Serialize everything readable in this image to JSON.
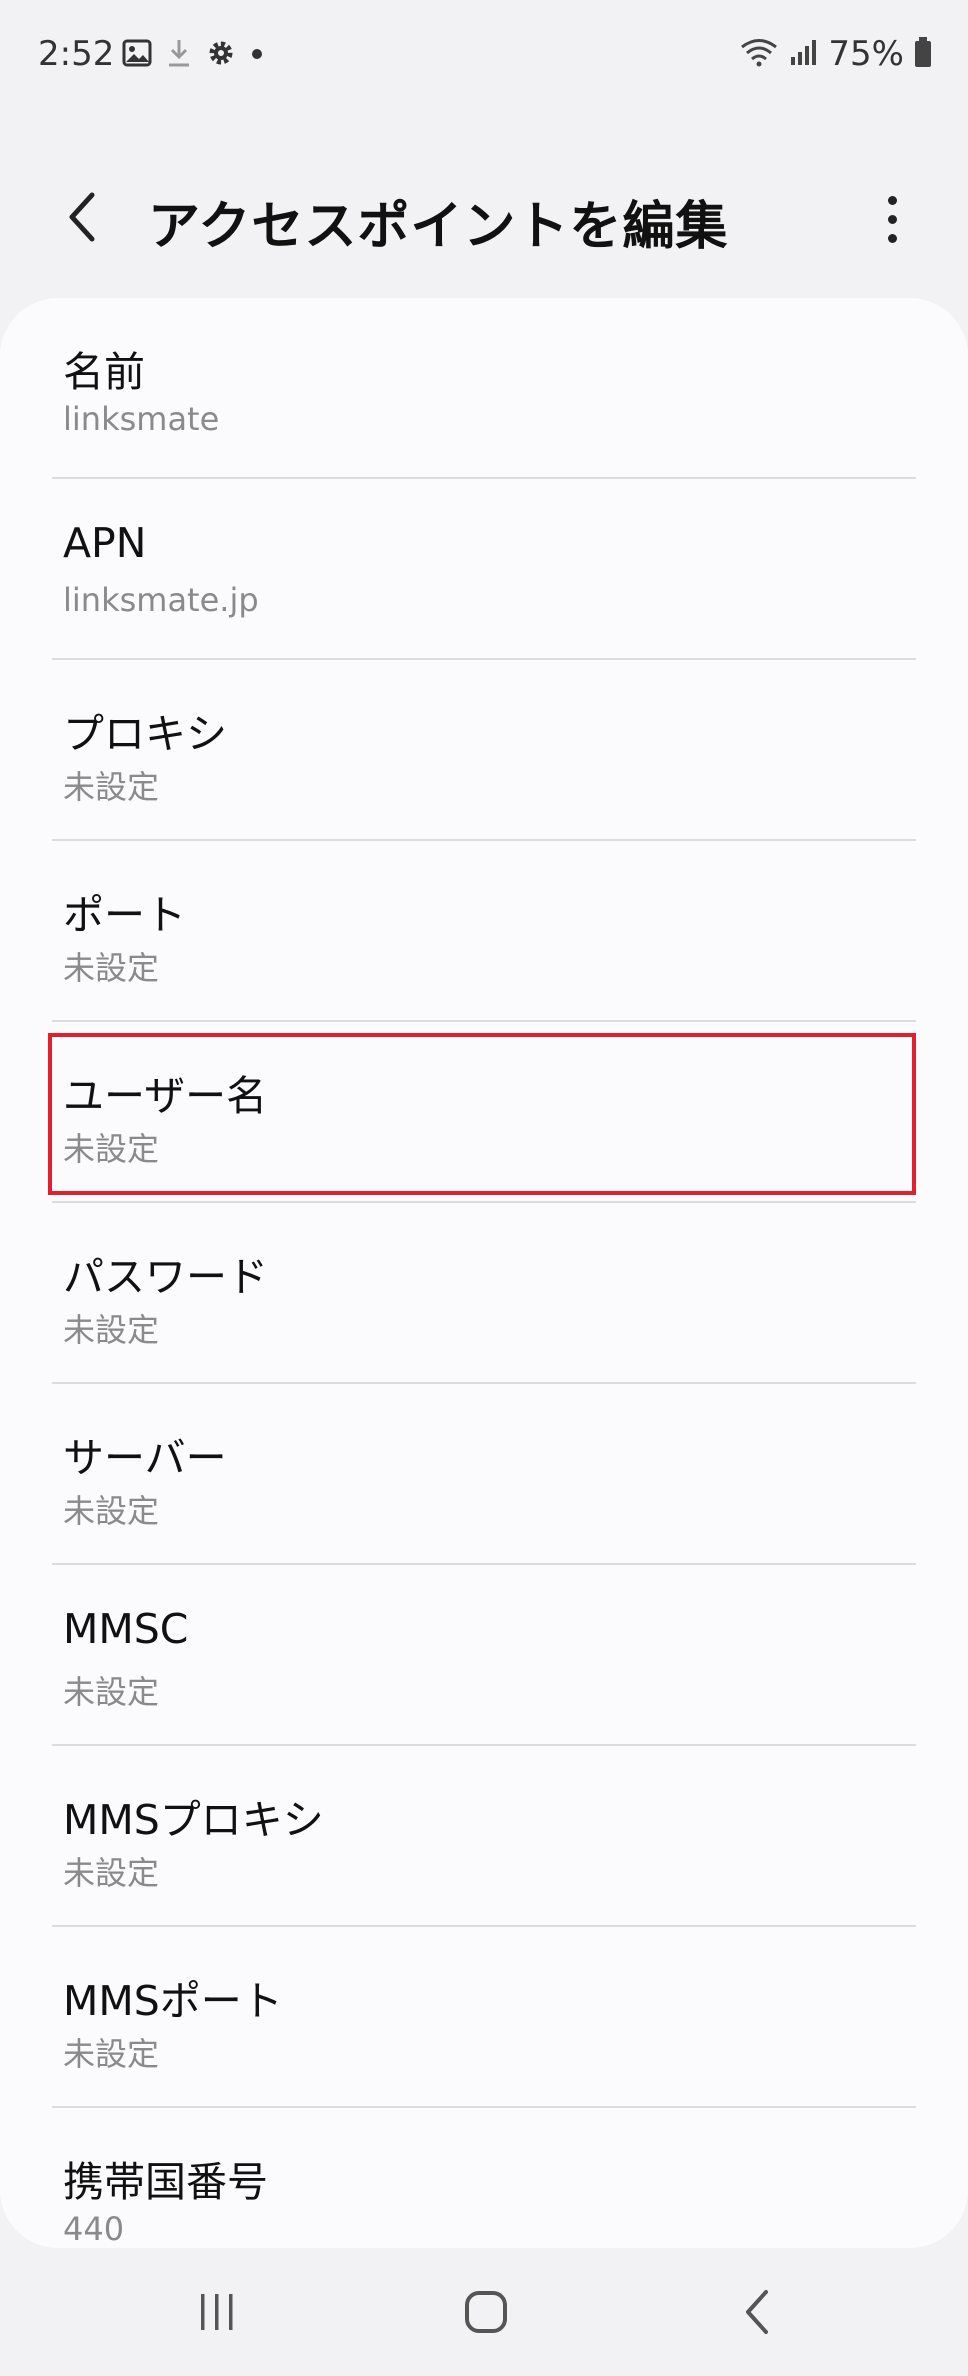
{
  "status_bar": {
    "time": "2:52",
    "battery_percent": "75%",
    "icons_left": [
      "image-icon",
      "download-icon",
      "gear-icon",
      "dot-icon"
    ],
    "icons_right": [
      "wifi-icon",
      "signal-icon",
      "battery-icon"
    ]
  },
  "header": {
    "title": "アクセスポイントを編集"
  },
  "settings": {
    "items": [
      {
        "title": "名前",
        "value": "linksmate"
      },
      {
        "title": "APN",
        "value": "linksmate.jp"
      },
      {
        "title": "プロキシ",
        "value": "未設定"
      },
      {
        "title": "ポート",
        "value": "未設定"
      },
      {
        "title": "ユーザー名",
        "value": "未設定"
      },
      {
        "title": "パスワード",
        "value": "未設定"
      },
      {
        "title": "サーバー",
        "value": "未設定"
      },
      {
        "title": "MMSC",
        "value": "未設定"
      },
      {
        "title": "MMSプロキシ",
        "value": "未設定"
      },
      {
        "title": "MMSポート",
        "value": "未設定"
      },
      {
        "title": "携帯国番号",
        "value": "440"
      }
    ]
  },
  "highlight": {
    "target": "ユーザー名",
    "color": "#e0202a"
  },
  "nav_bar": {
    "buttons": [
      "recent-apps-icon",
      "home-icon",
      "back-icon"
    ]
  }
}
